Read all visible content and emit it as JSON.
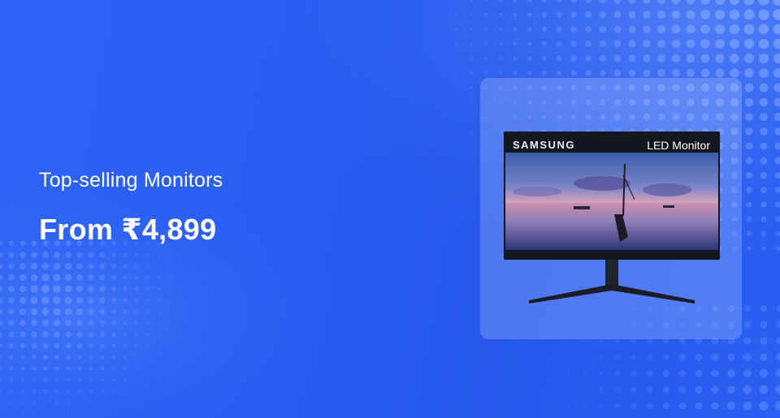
{
  "banner": {
    "headline": "Top-selling Monitors",
    "price": "From ₹4,899"
  },
  "product": {
    "brand": "SAMSUNG",
    "badge": "LED Monitor"
  },
  "colors": {
    "background": "#2a5cf0",
    "card": "#7ea0ff",
    "text": "#ffffff"
  }
}
